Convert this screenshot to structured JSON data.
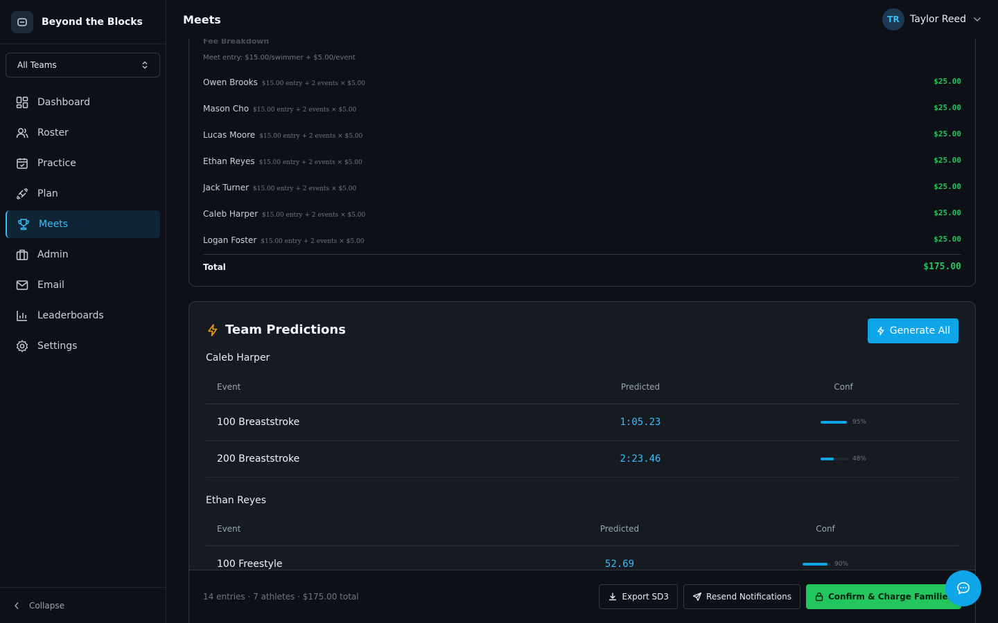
{
  "brand": {
    "name": "Beyond the Blocks",
    "icon": "swim-block-icon"
  },
  "team_select": {
    "value": "All Teams"
  },
  "nav": {
    "items": [
      {
        "label": "Dashboard",
        "icon": "dashboard-icon"
      },
      {
        "label": "Roster",
        "icon": "users-icon"
      },
      {
        "label": "Practice",
        "icon": "calendar-check-icon"
      },
      {
        "label": "Plan",
        "icon": "dumbbell-icon"
      },
      {
        "label": "Meets",
        "icon": "trophy-icon",
        "active": true
      },
      {
        "label": "Admin",
        "icon": "briefcase-icon"
      },
      {
        "label": "Email",
        "icon": "mail-icon"
      },
      {
        "label": "Leaderboards",
        "icon": "bar-chart-icon"
      },
      {
        "label": "Settings",
        "icon": "gear-icon"
      }
    ],
    "collapse_label": "Collapse"
  },
  "header": {
    "title": "Meets",
    "user": {
      "initials": "TR",
      "name": "Taylor Reed"
    }
  },
  "fee": {
    "title": "Fee Breakdown",
    "subtitle": "Meet entry: $15.00/swimmer + $5.00/event",
    "rows": [
      {
        "name": "Owen Brooks",
        "detail": "$15.00 entry + 2 events × $5.00",
        "amount": "$25.00"
      },
      {
        "name": "Mason Cho",
        "detail": "$15.00 entry + 2 events × $5.00",
        "amount": "$25.00"
      },
      {
        "name": "Lucas Moore",
        "detail": "$15.00 entry + 2 events × $5.00",
        "amount": "$25.00"
      },
      {
        "name": "Ethan Reyes",
        "detail": "$15.00 entry + 2 events × $5.00",
        "amount": "$25.00"
      },
      {
        "name": "Jack Turner",
        "detail": "$15.00 entry + 2 events × $5.00",
        "amount": "$25.00"
      },
      {
        "name": "Caleb Harper",
        "detail": "$15.00 entry + 2 events × $5.00",
        "amount": "$25.00"
      },
      {
        "name": "Logan Foster",
        "detail": "$15.00 entry + 2 events × $5.00",
        "amount": "$25.00"
      }
    ],
    "total_label": "Total",
    "total_amount": "$175.00"
  },
  "predictions": {
    "title": "Team Predictions",
    "generate_label": "Generate All",
    "columns": {
      "event": "Event",
      "predicted": "Predicted",
      "conf": "Conf"
    },
    "athletes": [
      {
        "name": "Caleb Harper",
        "rows": [
          {
            "event": "100 Breaststroke",
            "predicted": "1:05.23",
            "conf": 0.95,
            "conf_label": "95%"
          },
          {
            "event": "200 Breaststroke",
            "predicted": "2:23.46",
            "conf": 0.48,
            "conf_label": "48%"
          }
        ]
      },
      {
        "name": "Ethan Reyes",
        "rows": [
          {
            "event": "100 Freestyle",
            "predicted": "52.69",
            "conf": 0.9,
            "conf_label": "90%"
          }
        ]
      }
    ]
  },
  "action_bar": {
    "summary": "14 entries · 7 athletes · $175.00 total",
    "export_label": "Export SD3",
    "resend_label": "Resend Notifications",
    "confirm_label": "Confirm & Charge Families"
  },
  "colors": {
    "accent": "#0ea5e9",
    "success": "#22c55e",
    "background": "#0d1117"
  }
}
